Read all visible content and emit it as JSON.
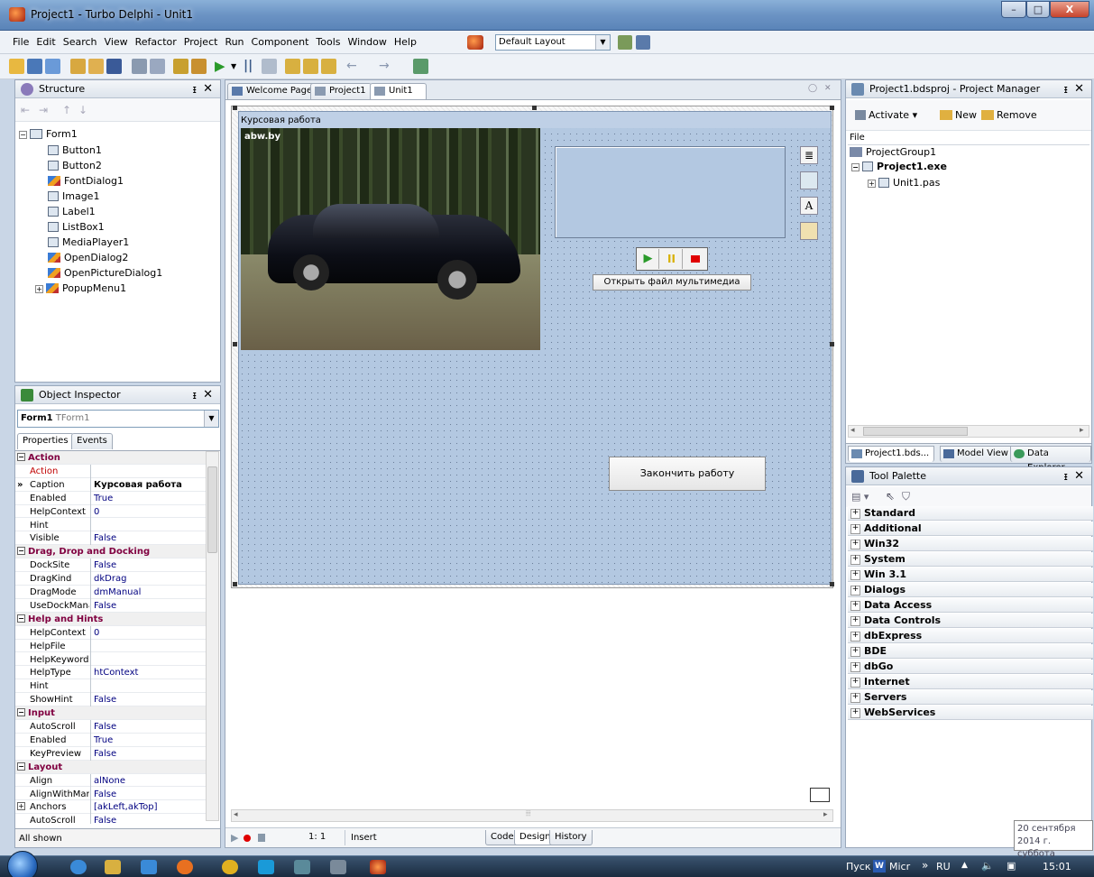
{
  "window": {
    "title": "Project1 - Turbo Delphi - Unit1",
    "min": "–",
    "max": "□",
    "close": "X"
  },
  "menu": [
    "File",
    "Edit",
    "Search",
    "View",
    "Refactor",
    "Project",
    "Run",
    "Component",
    "Tools",
    "Window",
    "Help"
  ],
  "layout_combo": "Default Layout",
  "structure": {
    "title": "Structure",
    "root": "Form1",
    "items": [
      "Button1",
      "Button2",
      "FontDialog1",
      "Image1",
      "Label1",
      "ListBox1",
      "MediaPlayer1",
      "OpenDialog2",
      "OpenPictureDialog1",
      "PopupMenu1"
    ]
  },
  "object_inspector": {
    "title": "Object Inspector",
    "selected_name": "Form1",
    "selected_type": "TForm1",
    "tabs": [
      "Properties",
      "Events"
    ],
    "rows": [
      {
        "cat": "Action"
      },
      {
        "n": "Action",
        "v": "",
        "red": true
      },
      {
        "n": "Caption",
        "v": "Курсовая работа",
        "bold": true,
        "sel": true
      },
      {
        "n": "Enabled",
        "v": "True"
      },
      {
        "n": "HelpContext",
        "v": "0"
      },
      {
        "n": "Hint",
        "v": ""
      },
      {
        "n": "Visible",
        "v": "False"
      },
      {
        "cat": "Drag, Drop and Docking"
      },
      {
        "n": "DockSite",
        "v": "False"
      },
      {
        "n": "DragKind",
        "v": "dkDrag"
      },
      {
        "n": "DragMode",
        "v": "dmManual"
      },
      {
        "n": "UseDockManage",
        "v": "False"
      },
      {
        "cat": "Help and Hints"
      },
      {
        "n": "HelpContext",
        "v": "0"
      },
      {
        "n": "HelpFile",
        "v": ""
      },
      {
        "n": "HelpKeyword",
        "v": ""
      },
      {
        "n": "HelpType",
        "v": "htContext"
      },
      {
        "n": "Hint",
        "v": ""
      },
      {
        "n": "ShowHint",
        "v": "False"
      },
      {
        "cat": "Input"
      },
      {
        "n": "AutoScroll",
        "v": "False"
      },
      {
        "n": "Enabled",
        "v": "True"
      },
      {
        "n": "KeyPreview",
        "v": "False"
      },
      {
        "cat": "Layout"
      },
      {
        "n": "Align",
        "v": "alNone"
      },
      {
        "n": "AlignWithMargins",
        "v": "False"
      },
      {
        "n": "Anchors",
        "v": "[akLeft,akTop]",
        "expand": true
      },
      {
        "n": "AutoScroll",
        "v": "False"
      }
    ],
    "status": "All shown"
  },
  "editor": {
    "tabs": [
      "Welcome Page",
      "Project1",
      "Unit1"
    ],
    "form_caption": "Курсовая работа",
    "image_watermark": "abw.by",
    "open_media_button": "Открыть файл мультимедиа",
    "finish_button": "Закончить работу",
    "status": {
      "position": "1:   1",
      "mode": "Insert"
    },
    "bottom_tabs": [
      "Code",
      "Design",
      "History"
    ]
  },
  "project_manager": {
    "title": "Project1.bdsproj - Project Manager",
    "toolbar": [
      "Activate",
      "New",
      "Remove"
    ],
    "column": "File",
    "group": "ProjectGroup1",
    "project": "Project1.exe",
    "unit": "Unit1.pas",
    "tabs": [
      "Project1.bds...",
      "Model View",
      "Data Explorer"
    ]
  },
  "tool_palette": {
    "title": "Tool Palette",
    "categories": [
      "Standard",
      "Additional",
      "Win32",
      "System",
      "Win 3.1",
      "Dialogs",
      "Data Access",
      "Data Controls",
      "dbExpress",
      "BDE",
      "dbGo",
      "Internet",
      "Servers",
      "WebServices"
    ]
  },
  "taskbar": {
    "start_label": "Пуск",
    "word_label": "Micr",
    "overflow": "»",
    "lang": "RU",
    "time": "15:01",
    "tooltip_date": "20 сентября 2014 г.",
    "tooltip_day": "суббота"
  }
}
